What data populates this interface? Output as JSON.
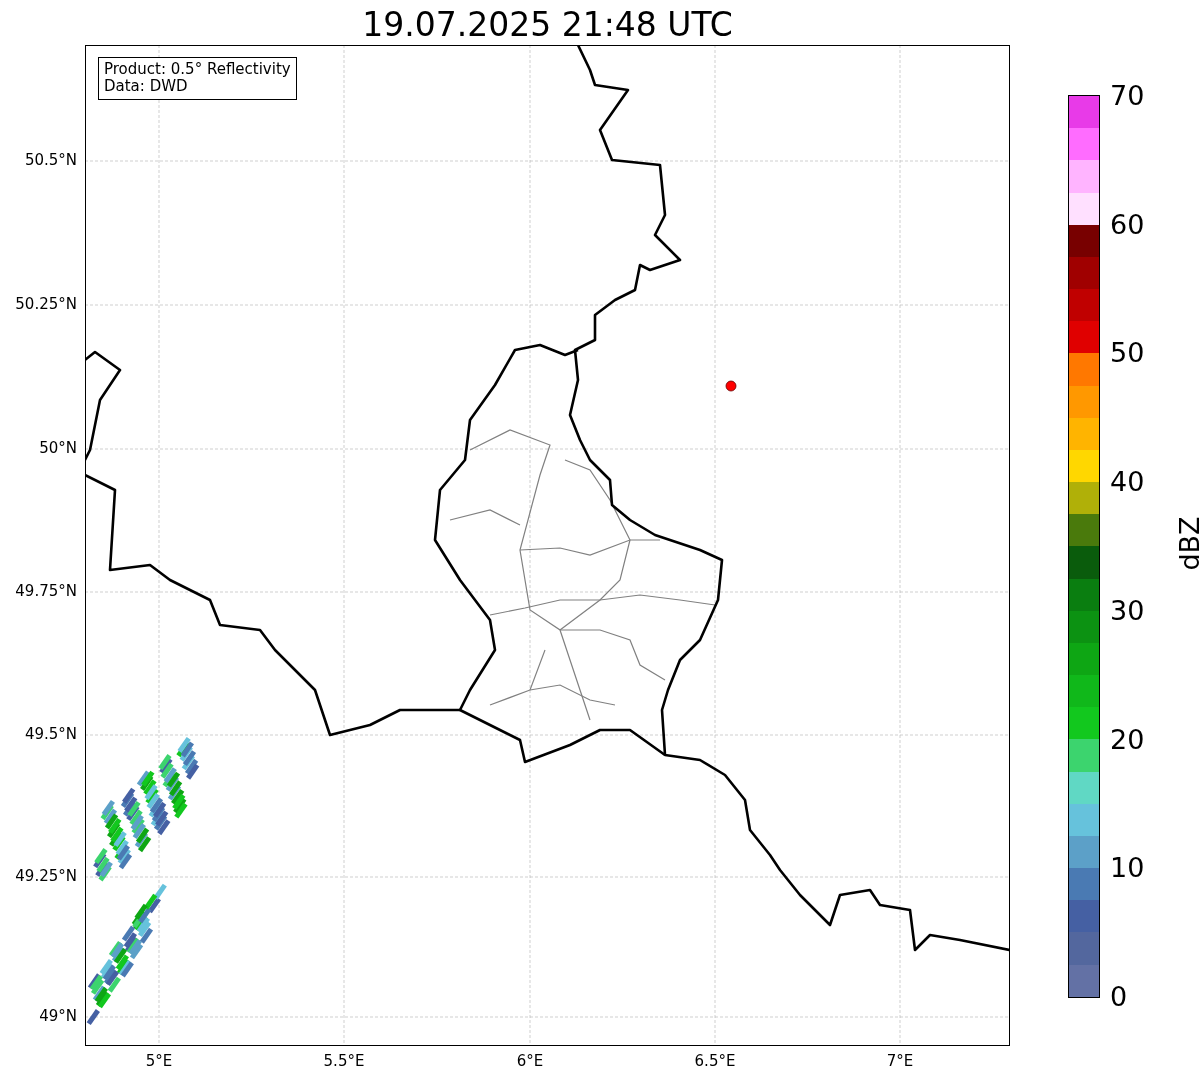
{
  "title": "19.07.2025 21:48 UTC",
  "info_box": [
    "Product: 0.5° Reflectivity",
    "Data: DWD"
  ],
  "map": {
    "y_ticks": [
      "50.5°N",
      "50.25°N",
      "50°N",
      "49.75°N",
      "49.5°N",
      "49.25°N",
      "49°N"
    ],
    "x_ticks": [
      "5°E",
      "5.5°E",
      "6°E",
      "6.5°E",
      "7°E"
    ]
  },
  "colorbar": {
    "label": "dBZ",
    "ticks": [
      "70",
      "60",
      "50",
      "40",
      "30",
      "20",
      "10",
      "0"
    ],
    "bins": [
      {
        "color": "#e83ae8"
      },
      {
        "color": "#ff6cff"
      },
      {
        "color": "#ffb4ff"
      },
      {
        "color": "#ffe0ff"
      },
      {
        "color": "#780000"
      },
      {
        "color": "#a00000"
      },
      {
        "color": "#c00000"
      },
      {
        "color": "#e00000"
      },
      {
        "color": "#ff7800"
      },
      {
        "color": "#ff9800"
      },
      {
        "color": "#ffb400"
      },
      {
        "color": "#ffd700"
      },
      {
        "color": "#b0b008"
      },
      {
        "color": "#4a7a0c"
      },
      {
        "color": "#0a5c0c"
      },
      {
        "color": "#0a7e10"
      },
      {
        "color": "#0c9212"
      },
      {
        "color": "#0ea614"
      },
      {
        "color": "#10b81a"
      },
      {
        "color": "#12c81e"
      },
      {
        "color": "#3cd46e"
      },
      {
        "color": "#60d8c4"
      },
      {
        "color": "#66c2dc"
      },
      {
        "color": "#5ca0c8"
      },
      {
        "color": "#4a7ab3"
      },
      {
        "color": "#4560a3"
      },
      {
        "color": "#53679e"
      },
      {
        "color": "#6371a5"
      }
    ]
  }
}
